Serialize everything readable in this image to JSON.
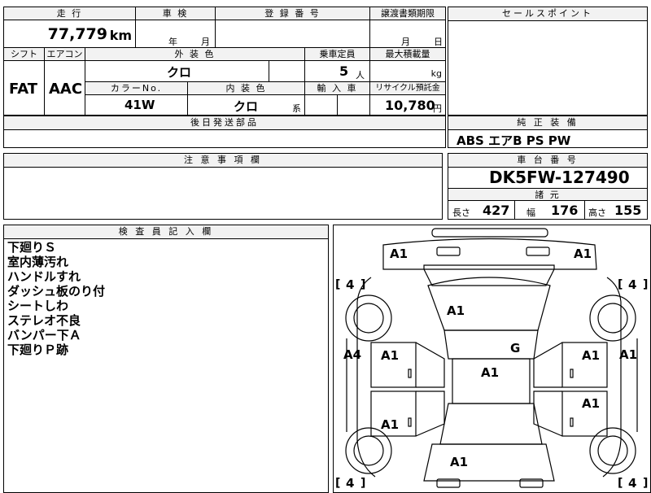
{
  "top": {
    "mileage_label": "走 行",
    "mileage_value": "77,779",
    "mileage_unit": "km",
    "inspection_label": "車 検",
    "inspection_year": "年",
    "inspection_month": "月",
    "registration_label": "登 録 番 号",
    "transfer_label": "譲渡書類期限",
    "transfer_month": "月",
    "transfer_day": "日",
    "sales_point_label": "セールスポイント"
  },
  "specs": {
    "shift_label": "シフト",
    "aircon_label": "エアコン",
    "shift_value": "FAT",
    "aircon_value": "AAC",
    "exterior_label": "外 装 色",
    "exterior_value": "クロ",
    "capacity_label": "乗車定員",
    "capacity_value": "5",
    "capacity_unit": "人",
    "load_label": "最大積載量",
    "load_unit": "kg",
    "color_no_label": "カラーNo.",
    "color_no_value": "41W",
    "interior_label": "内 装 色",
    "interior_value": "クロ",
    "interior_unit": "系",
    "import_label": "輸 入 車",
    "recycle_label": "リサイクル預託金",
    "recycle_value": "10,780",
    "recycle_unit": "円",
    "parts_label": "後日発送部品"
  },
  "equipment": {
    "label": "純 正 装 備",
    "value": "ABS エアB PS PW"
  },
  "notes_section": {
    "label": "注 意 事 項 欄"
  },
  "chassis": {
    "label": "車 台 番 号",
    "value": "DK5FW-127490",
    "dims_label": "諸 元",
    "length_label": "長さ",
    "length_value": "427",
    "width_label": "幅",
    "width_value": "176",
    "height_label": "高さ",
    "height_value": "155"
  },
  "inspector": {
    "label": "検 査 員 記 入 欄",
    "lines": [
      "下廻りＳ",
      "室内薄汚れ",
      "ハンドルすれ",
      "ダッシュ板のり付",
      "シートしわ",
      "ステレオ不良",
      "バンパー下Ａ",
      "下廻りＰ跡"
    ]
  },
  "diagram": {
    "marks": {
      "front_left": "A1",
      "front_right": "A1",
      "hood": "A1",
      "roof_g": "G",
      "roof": "A1",
      "door_fl": "A1",
      "door_fr": "A1",
      "door_rl": "A1",
      "door_rr": "A1",
      "side_left": "A4",
      "side_right": "A1",
      "rear": "A1",
      "tire_fl": "4",
      "tire_fr": "4",
      "tire_rl": "4",
      "tire_rr": "4"
    }
  }
}
